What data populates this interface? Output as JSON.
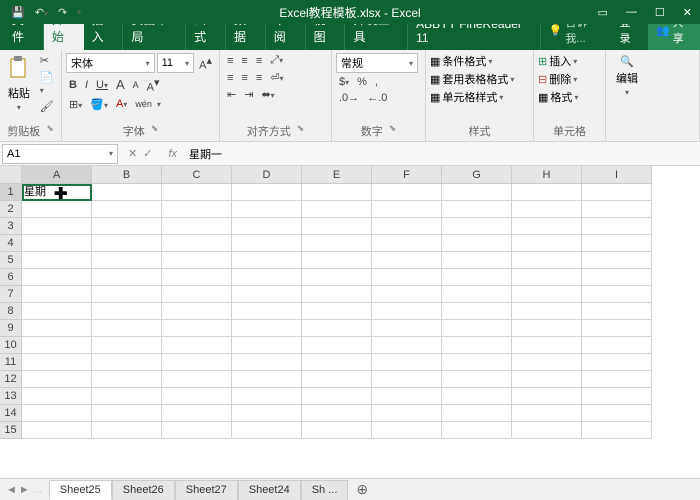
{
  "title": "Excel教程模板.xlsx - Excel",
  "tabs": {
    "file": "文件",
    "home": "开始",
    "insert": "插入",
    "layout": "页面布局",
    "formulas": "公式",
    "data": "数据",
    "review": "审阅",
    "view": "视图",
    "dev": "开发工具",
    "abbyy": "ABBYY FineReader 11"
  },
  "tell": "告诉我...",
  "login": "登录",
  "share": "共享",
  "groups": {
    "clipboard": "剪贴板",
    "font": "字体",
    "align": "对齐方式",
    "number": "数字",
    "styles": "样式",
    "cells": "单元格",
    "editing": "编辑"
  },
  "clipboard": {
    "paste": "粘贴"
  },
  "font": {
    "name": "宋体",
    "size": "11",
    "b": "B",
    "i": "I",
    "u": "U",
    "wen": "wén"
  },
  "number": {
    "format": "常规"
  },
  "styles": {
    "cond": "条件格式",
    "table": "套用表格格式",
    "cell": "单元格样式"
  },
  "cells": {
    "insert": "插入",
    "delete": "删除",
    "format": "格式"
  },
  "editing": {
    "label": "编辑"
  },
  "namebox": "A1",
  "formula": "星期一",
  "columns": [
    "A",
    "B",
    "C",
    "D",
    "E",
    "F",
    "G",
    "H",
    "I"
  ],
  "rows": 15,
  "cellA1": "星期",
  "sheets": {
    "nav": [
      "◄",
      "►"
    ],
    "tabs": [
      "Sheet25",
      "Sheet26",
      "Sheet27",
      "Sheet24",
      "Sh ..."
    ],
    "active": 0
  }
}
